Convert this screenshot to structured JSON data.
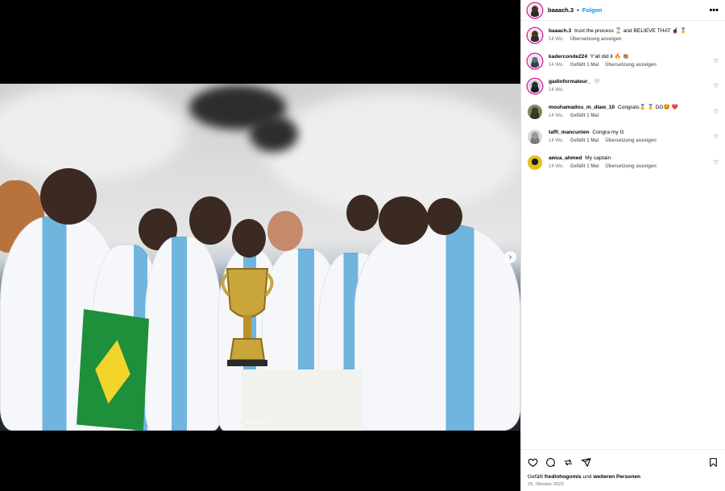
{
  "post": {
    "username": "baaach.3",
    "separator": "•",
    "follow_label": "Folgen",
    "more_label": "•••"
  },
  "comments": [
    {
      "user": "baaach.3",
      "text": "trust the process ⏳ and BELIEVE THAT ☝🏿 🥇",
      "time": "14 Wo.",
      "likes": "",
      "translate": "Übersetzung anzeigen",
      "avatar_color": "#3b2a22"
    },
    {
      "user": "kaderconde224",
      "text": "Y'all did it 🔥 👏🏽",
      "time": "14 Wo.",
      "likes": "Gefällt 1 Mal",
      "translate": "Übersetzung anzeigen",
      "avatar_color": "#5b6470"
    },
    {
      "user": "gadioformateur_",
      "text": "🤍",
      "time": "14 Wo.",
      "likes": "",
      "translate": "",
      "avatar_color": "#2e2e35"
    },
    {
      "user": "mouhamadou_m_diaw_10",
      "text": "Congrats🏅 🥇 DG🤩 ❤️",
      "time": "14 Wo.",
      "likes": "Gefällt 1 Mal",
      "translate": "",
      "avatar_color": "#3f4a2c"
    },
    {
      "user": "taffi_mancunien",
      "text": "Congra my G",
      "time": "14 Wo.",
      "likes": "Gefällt 1 Mal",
      "translate": "Übersetzung anzeigen",
      "avatar_color": "#8d8d8d"
    },
    {
      "user": "awua_ahmed",
      "text": "My captain",
      "time": "14 Wo.",
      "likes": "Gefällt 1 Mal",
      "translate": "Übersetzung anzeigen",
      "avatar_color": "#e2c21a"
    }
  ],
  "footer": {
    "likes_prefix": "Gefällt",
    "likes_user": "fredinhogomis",
    "likes_mid": "und",
    "likes_others": "weiteren Personen",
    "date": "25. Oktober 2025"
  },
  "icons": [
    "heart-icon",
    "comment-icon",
    "share-icon",
    "send-icon",
    "bookmark-icon",
    "chevron-right-icon"
  ],
  "colors": {
    "link": "#0095f6",
    "muted": "#737373",
    "story_ring": "#d6249f"
  }
}
